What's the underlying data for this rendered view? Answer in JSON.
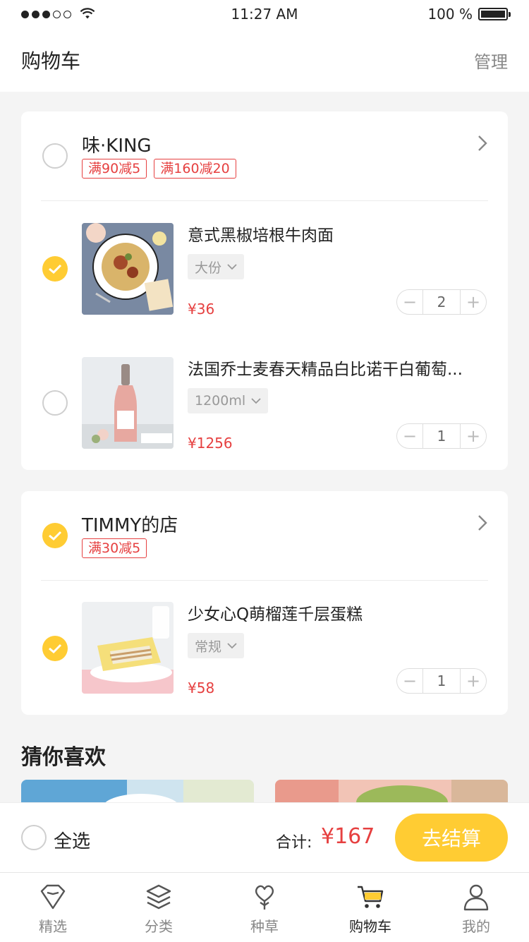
{
  "status_bar": {
    "time": "11:27 AM",
    "battery": "100 %"
  },
  "header": {
    "title": "购物车",
    "manage": "管理"
  },
  "shops": [
    {
      "name": "味·KING",
      "checked": false,
      "promos": [
        "满90减5",
        "满160减20"
      ],
      "items": [
        {
          "name": "意式黑椒培根牛肉面",
          "spec": "大份",
          "price": "¥36",
          "qty": "2",
          "checked": true,
          "thumb": "pasta"
        },
        {
          "name": "法国乔士麦春天精品白比诺干白葡萄...",
          "spec": "1200ml",
          "price": "¥1256",
          "qty": "1",
          "checked": false,
          "thumb": "wine"
        }
      ]
    },
    {
      "name": "TIMMY的店",
      "checked": true,
      "promos": [
        "满30减5"
      ],
      "items": [
        {
          "name": "少女心Q萌榴莲千层蛋糕",
          "spec": "常规",
          "price": "¥58",
          "qty": "1",
          "checked": true,
          "thumb": "cake"
        }
      ]
    }
  ],
  "recommend": {
    "title": "猜你喜欢"
  },
  "checkout": {
    "select_all": "全选",
    "total_label": "合计:",
    "total_value": "¥167",
    "button": "去结算"
  },
  "tabs": [
    {
      "label": "精选",
      "icon": "diamond-icon",
      "active": false
    },
    {
      "label": "分类",
      "icon": "layers-icon",
      "active": false
    },
    {
      "label": "种草",
      "icon": "heart-plant-icon",
      "active": false
    },
    {
      "label": "购物车",
      "icon": "cart-icon",
      "active": true
    },
    {
      "label": "我的",
      "icon": "user-icon",
      "active": false
    }
  ],
  "colors": {
    "accent": "#ffcc33",
    "price": "#e64040",
    "background": "#f4f4f4"
  }
}
